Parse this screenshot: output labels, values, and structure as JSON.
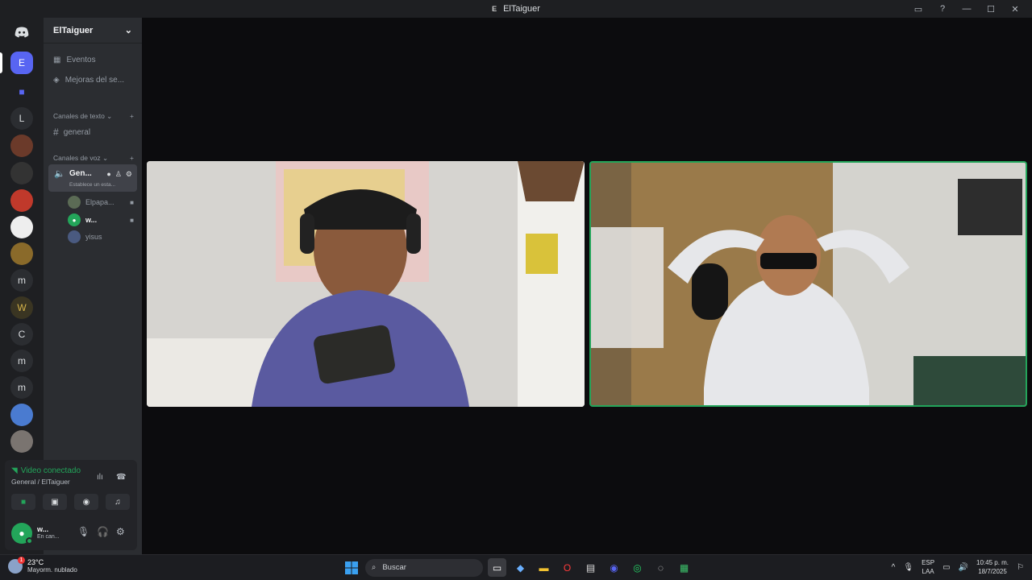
{
  "window": {
    "title": "ElTaiguer",
    "title_icon": "E"
  },
  "guilds": [
    {
      "label": "E",
      "selected": true
    },
    {
      "label": "",
      "icon": "folder-icon"
    },
    {
      "label": "L"
    },
    {
      "label": "",
      "icon": "server-avatar-1"
    },
    {
      "label": "",
      "icon": "server-avatar-2"
    },
    {
      "label": "",
      "icon": "server-avatar-3"
    },
    {
      "label": "",
      "icon": "server-avatar-4"
    },
    {
      "label": "",
      "icon": "server-avatar-5"
    },
    {
      "label": "m"
    },
    {
      "label": "",
      "icon": "server-avatar-6"
    },
    {
      "label": "C"
    },
    {
      "label": "m"
    },
    {
      "label": "m"
    },
    {
      "label": "",
      "icon": "server-avatar-7"
    },
    {
      "label": "",
      "icon": "server-avatar-8"
    }
  ],
  "server": {
    "name": "ElTaiguer"
  },
  "nav": {
    "events": "Eventos",
    "boosts": "Mejoras del se..."
  },
  "text_category": {
    "label": "Canales de texto"
  },
  "text_channels": [
    {
      "name": "general"
    }
  ],
  "voice_category": {
    "label": "Canales de voz"
  },
  "voice_channel": {
    "name": "Gen...",
    "status": "Establece un esta..."
  },
  "voice_members": [
    {
      "name": "Elpapa...",
      "camera": true
    },
    {
      "name": "w...",
      "camera": true
    },
    {
      "name": "yisus",
      "camera": false
    }
  ],
  "voice_connection": {
    "status": "Video conectado",
    "location": "General / ElTaiguer"
  },
  "user": {
    "name": "w...",
    "status": "En can..."
  },
  "taskbar": {
    "weather_temp": "23°C",
    "weather_desc": "Mayorm. nublado",
    "search_placeholder": "Buscar",
    "lang_1": "ESP",
    "lang_2": "LAA",
    "time": "10:45 p. m.",
    "date": "18/7/2025"
  },
  "colors": {
    "accent": "#5865f2",
    "connected": "#23a55a",
    "speaking_border": "#23a55a"
  }
}
